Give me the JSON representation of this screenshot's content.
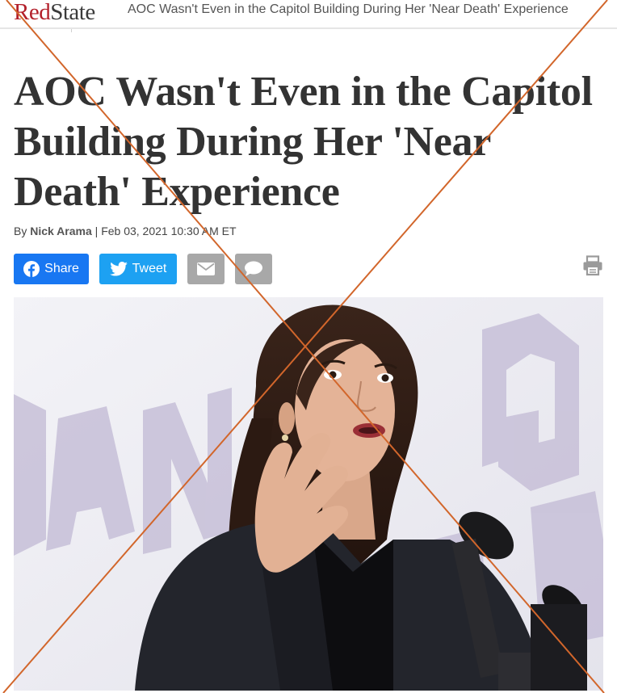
{
  "site": {
    "logo_red": "Red",
    "logo_rest": "State",
    "topbar_title": "AOC Wasn't Even in the Capitol Building During Her 'Near Death' Experience",
    "logo_color": "#b3202b"
  },
  "article": {
    "headline": "AOC Wasn't Even in the Capitol Building During Her 'Near Death' Experience",
    "byline_prefix": "By ",
    "author": "Nick Arama",
    "byline_sep": " | ",
    "date": "Feb 03, 2021 10:30 AM ET"
  },
  "share": {
    "facebook_label": "Share",
    "twitter_label": "Tweet",
    "facebook_color": "#1877f2",
    "twitter_color": "#1da1f2",
    "icons": [
      "facebook-icon",
      "twitter-icon",
      "email-icon",
      "comment-icon",
      "print-icon"
    ]
  },
  "hero": {
    "description_icon": "photo",
    "overlay_mark_color": "#d2662b"
  }
}
